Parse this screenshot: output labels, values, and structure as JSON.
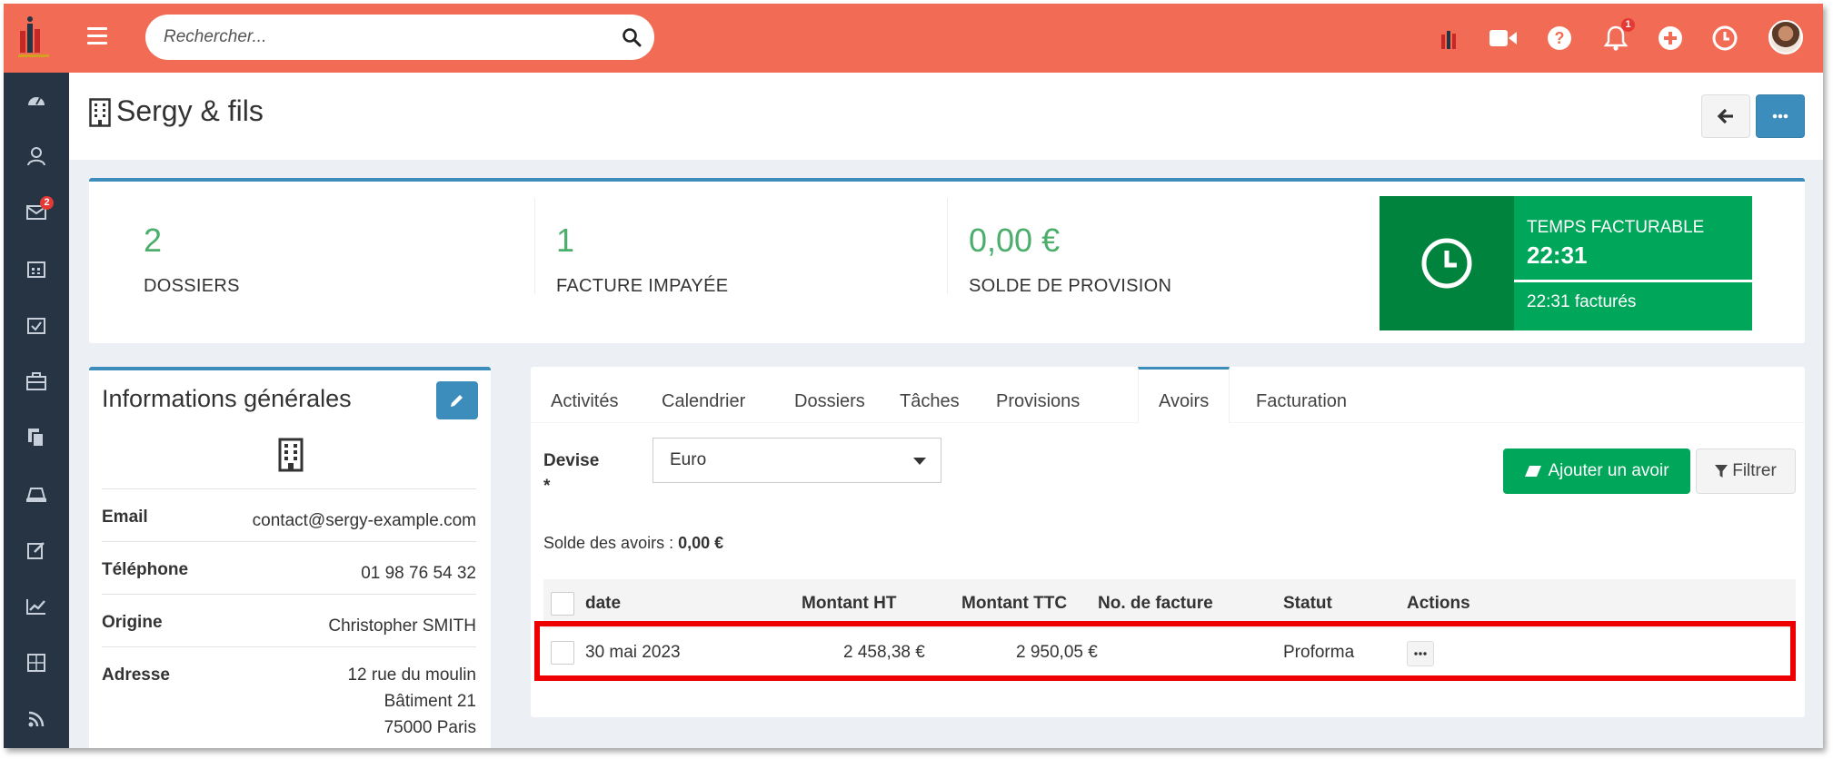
{
  "header": {
    "search_placeholder": "Rechercher...",
    "notifications_count": "1"
  },
  "sidebar": {
    "items": [
      {
        "icon": "dashboard-icon"
      },
      {
        "icon": "contacts-icon"
      },
      {
        "icon": "mail-icon",
        "badge": "2"
      },
      {
        "icon": "calendar-icon"
      },
      {
        "icon": "tasks-icon"
      },
      {
        "icon": "briefcase-icon"
      },
      {
        "icon": "documents-icon"
      },
      {
        "icon": "billing-icon"
      },
      {
        "icon": "edit-icon"
      },
      {
        "icon": "chart-icon"
      },
      {
        "icon": "calculator-icon"
      },
      {
        "icon": "rss-icon"
      }
    ]
  },
  "page": {
    "title": "Sergy & fils"
  },
  "stats": {
    "dossiers_value": "2",
    "dossiers_label": "DOSSIERS",
    "factures_value": "1",
    "factures_label": "FACTURE IMPAYÉE",
    "solde_value": "0,00 €",
    "solde_label": "SOLDE DE PROVISION",
    "time_label": "TEMPS FACTURABLE",
    "time_value": "22:31",
    "time_billed": "22:31 facturés"
  },
  "info": {
    "title": "Informations générales",
    "rows": [
      {
        "key": "Email",
        "value": "contact@sergy-example.com"
      },
      {
        "key": "Téléphone",
        "value": "01 98 76 54 32"
      },
      {
        "key": "Origine",
        "value": "Christopher SMITH"
      },
      {
        "key": "Adresse",
        "lines": [
          "12 rue du moulin",
          "Bâtiment 21",
          "75000 Paris"
        ]
      }
    ]
  },
  "tabs": {
    "items": [
      "Activités",
      "Calendrier",
      "Dossiers",
      "Tâches",
      "Provisions",
      "Avoirs",
      "Facturation"
    ],
    "active": "Avoirs"
  },
  "avoirs": {
    "devise_label": "Devise",
    "devise_required": "*",
    "devise_value": "Euro",
    "add_label": "Ajouter un avoir",
    "filter_label": "Filtrer",
    "balance_label": "Solde des avoirs :",
    "balance_value": "0,00 €",
    "columns": [
      "date",
      "Montant HT",
      "Montant TTC",
      "No. de facture",
      "Statut",
      "Actions"
    ],
    "rows": [
      {
        "date": "30 mai 2023",
        "montant_ht": "2 458,38 €",
        "montant_ttc": "2 950,05 €",
        "no_facture": "",
        "statut": "Proforma"
      }
    ],
    "highlight_color": "#ee0000"
  },
  "colors": {
    "topbar": "#f26b54",
    "sidebar": "#263443",
    "accent": "#3c8dbc",
    "success": "#00a65a",
    "success_dark": "#00843d",
    "stat_number": "#4cae6c"
  }
}
